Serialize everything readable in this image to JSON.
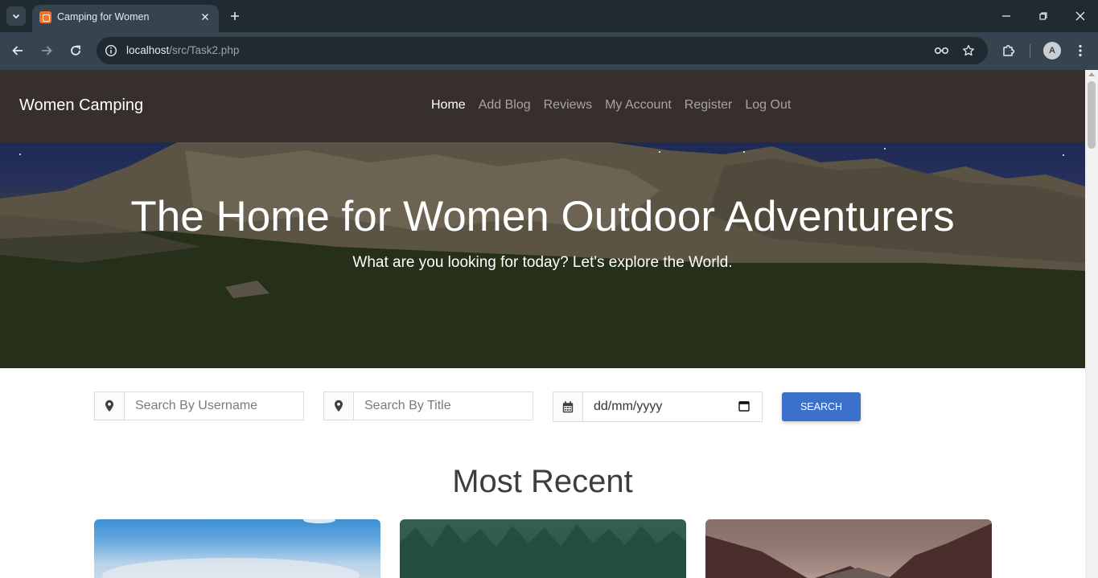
{
  "browser": {
    "tab_title": "Camping for Women",
    "url_host": "localhost",
    "url_path": "/src/Task2.php",
    "profile_initial": "A"
  },
  "site": {
    "brand": "Women Camping",
    "nav": [
      "Home",
      "Add Blog",
      "Reviews",
      "My Account",
      "Register",
      "Log Out"
    ],
    "active_nav": "Home"
  },
  "hero": {
    "title": "The Home for Women Outdoor Adventurers",
    "subtitle": "What are you looking for today? Let's explore the World."
  },
  "search": {
    "username_placeholder": "Search By Username",
    "title_placeholder": "Search By Title",
    "date_placeholder": "dd/mm/yyyy",
    "button_label": "SEARCH"
  },
  "section": {
    "title": "Most Recent"
  },
  "colors": {
    "nav_bg": "#372f2d",
    "button": "#3b71ca"
  }
}
